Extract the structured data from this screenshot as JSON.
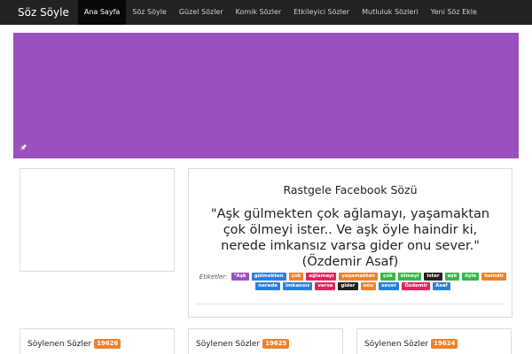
{
  "navbar": {
    "brand": "Söz Söyle",
    "items": [
      {
        "label": "Ana Sayfa",
        "active": true
      },
      {
        "label": "Söz Söyle"
      },
      {
        "label": "Güzel Sözler"
      },
      {
        "label": "Komik Sözler"
      },
      {
        "label": "Etkileyici Sözler"
      },
      {
        "label": "Mutluluk Sözleri"
      },
      {
        "label": "Yeni Söz Ekle"
      }
    ]
  },
  "banner": {
    "color": "#9b51bd",
    "icon": "pin-icon"
  },
  "quote": {
    "title": "Rastgele Facebook Sözü",
    "text": "\"Aşk gülmekten çok ağlamayı, yaşamaktan çok ölmeyi ister.. Ve aşk öyle haindir ki, nerede imkansız varsa gider onu sever.\" (Özdemir Asaf)",
    "tags_label": "Etiketler:",
    "tags": [
      {
        "label": "\"Aşk",
        "color": "#9b51bd"
      },
      {
        "label": "gülmekten",
        "color": "#2c7fd9"
      },
      {
        "label": "çok",
        "color": "#f0802b"
      },
      {
        "label": "ağlamayı",
        "color": "#e0245e"
      },
      {
        "label": "yaşamaktan",
        "color": "#f0802b"
      },
      {
        "label": "çok",
        "color": "#3cb44b"
      },
      {
        "label": "ölmeyi",
        "color": "#3cb44b"
      },
      {
        "label": "ister",
        "color": "#222222"
      },
      {
        "label": "aşk",
        "color": "#3cb44b"
      },
      {
        "label": "öyle",
        "color": "#3cb44b"
      },
      {
        "label": "haindir",
        "color": "#f0802b"
      },
      {
        "label": "nerede",
        "color": "#2c7fd9"
      },
      {
        "label": "imkansız",
        "color": "#2c7fd9"
      },
      {
        "label": "varsa",
        "color": "#e0245e"
      },
      {
        "label": "gider",
        "color": "#222222"
      },
      {
        "label": "onu",
        "color": "#f0802b"
      },
      {
        "label": "sever",
        "color": "#2c7fd9"
      },
      {
        "label": "Özdemir",
        "color": "#e0245e"
      },
      {
        "label": "Asaf",
        "color": "#2c7fd9"
      }
    ]
  },
  "cards": [
    {
      "title": "Söylenen Sözler",
      "count": "19626"
    },
    {
      "title": "Söylenen Sözler",
      "count": "19625"
    },
    {
      "title": "Söylenen Sözler",
      "count": "19624"
    }
  ]
}
